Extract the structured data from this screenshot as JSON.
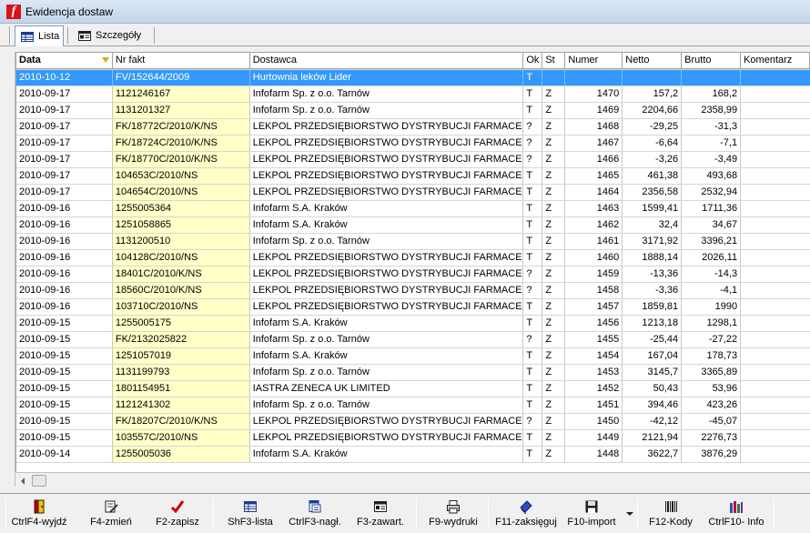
{
  "window": {
    "title": "Ewidencja dostaw"
  },
  "tabs": [
    {
      "label": "Lista"
    },
    {
      "label": "Szczegóły"
    }
  ],
  "columns": {
    "data": "Data",
    "nr": "Nr fakt",
    "dost": "Dostawca",
    "ok": "Ok",
    "st": "St",
    "num": "Numer",
    "netto": "Netto",
    "brutto": "Brutto",
    "kom": "Komentarz"
  },
  "rows": [
    {
      "data": "2010-10-12",
      "nr": "FV/152644/2009",
      "dost": "Hurtownia leków Lider",
      "ok": "T",
      "st": "",
      "num": "",
      "netto": "",
      "brutto": "",
      "kom": ""
    },
    {
      "data": "2010-09-17",
      "nr": "1121246167",
      "dost": "Infofarm Sp. z o.o. Tarnów",
      "ok": "T",
      "st": "Z",
      "num": "1470",
      "netto": "157,2",
      "brutto": "168,2",
      "kom": ""
    },
    {
      "data": "2010-09-17",
      "nr": "1131201327",
      "dost": "Infofarm Sp. z o.o. Tarnów",
      "ok": "T",
      "st": "Z",
      "num": "1469",
      "netto": "2204,66",
      "brutto": "2358,99",
      "kom": ""
    },
    {
      "data": "2010-09-17",
      "nr": "FK/18772C/2010/K/NS",
      "dost": "LEKPOL PRZEDSIĘBIORSTWO DYSTRYBUCJI FARMACEU",
      "ok": "?",
      "st": "Z",
      "num": "1468",
      "netto": "-29,25",
      "brutto": "-31,3",
      "kom": ""
    },
    {
      "data": "2010-09-17",
      "nr": "FK/18724C/2010/K/NS",
      "dost": "LEKPOL PRZEDSIĘBIORSTWO DYSTRYBUCJI FARMACEU",
      "ok": "?",
      "st": "Z",
      "num": "1467",
      "netto": "-6,64",
      "brutto": "-7,1",
      "kom": ""
    },
    {
      "data": "2010-09-17",
      "nr": "FK/18770C/2010/K/NS",
      "dost": "LEKPOL PRZEDSIĘBIORSTWO DYSTRYBUCJI FARMACEU",
      "ok": "?",
      "st": "Z",
      "num": "1466",
      "netto": "-3,26",
      "brutto": "-3,49",
      "kom": ""
    },
    {
      "data": "2010-09-17",
      "nr": "104653C/2010/NS",
      "dost": "LEKPOL PRZEDSIĘBIORSTWO DYSTRYBUCJI FARMACEU",
      "ok": "T",
      "st": "Z",
      "num": "1465",
      "netto": "461,38",
      "brutto": "493,68",
      "kom": ""
    },
    {
      "data": "2010-09-17",
      "nr": "104654C/2010/NS",
      "dost": "LEKPOL PRZEDSIĘBIORSTWO DYSTRYBUCJI FARMACEU",
      "ok": "T",
      "st": "Z",
      "num": "1464",
      "netto": "2356,58",
      "brutto": "2532,94",
      "kom": ""
    },
    {
      "data": "2010-09-16",
      "nr": "1255005364",
      "dost": "Infofarm S.A. Kraków",
      "ok": "T",
      "st": "Z",
      "num": "1463",
      "netto": "1599,41",
      "brutto": "1711,36",
      "kom": ""
    },
    {
      "data": "2010-09-16",
      "nr": "1251058865",
      "dost": "Infofarm S.A. Kraków",
      "ok": "T",
      "st": "Z",
      "num": "1462",
      "netto": "32,4",
      "brutto": "34,67",
      "kom": ""
    },
    {
      "data": "2010-09-16",
      "nr": "1131200510",
      "dost": "Infofarm Sp. z o.o. Tarnów",
      "ok": "T",
      "st": "Z",
      "num": "1461",
      "netto": "3171,92",
      "brutto": "3396,21",
      "kom": ""
    },
    {
      "data": "2010-09-16",
      "nr": "104128C/2010/NS",
      "dost": "LEKPOL PRZEDSIĘBIORSTWO DYSTRYBUCJI FARMACEU",
      "ok": "T",
      "st": "Z",
      "num": "1460",
      "netto": "1888,14",
      "brutto": "2026,11",
      "kom": ""
    },
    {
      "data": "2010-09-16",
      "nr": "18401C/2010/K/NS",
      "dost": "LEKPOL PRZEDSIĘBIORSTWO DYSTRYBUCJI FARMACEU",
      "ok": "?",
      "st": "Z",
      "num": "1459",
      "netto": "-13,36",
      "brutto": "-14,3",
      "kom": ""
    },
    {
      "data": "2010-09-16",
      "nr": "18560C/2010/K/NS",
      "dost": "LEKPOL PRZEDSIĘBIORSTWO DYSTRYBUCJI FARMACEU",
      "ok": "?",
      "st": "Z",
      "num": "1458",
      "netto": "-3,36",
      "brutto": "-4,1",
      "kom": ""
    },
    {
      "data": "2010-09-16",
      "nr": "103710C/2010/NS",
      "dost": "LEKPOL PRZEDSIĘBIORSTWO DYSTRYBUCJI FARMACEU",
      "ok": "T",
      "st": "Z",
      "num": "1457",
      "netto": "1859,81",
      "brutto": "1990",
      "kom": ""
    },
    {
      "data": "2010-09-15",
      "nr": "1255005175",
      "dost": "Infofarm S.A. Kraków",
      "ok": "T",
      "st": "Z",
      "num": "1456",
      "netto": "1213,18",
      "brutto": "1298,1",
      "kom": ""
    },
    {
      "data": "2010-09-15",
      "nr": "FK/2132025822",
      "dost": "Infofarm Sp. z o.o. Tarnów",
      "ok": "?",
      "st": "Z",
      "num": "1455",
      "netto": "-25,44",
      "brutto": "-27,22",
      "kom": ""
    },
    {
      "data": "2010-09-15",
      "nr": "1251057019",
      "dost": "Infofarm S.A. Kraków",
      "ok": "T",
      "st": "Z",
      "num": "1454",
      "netto": "167,04",
      "brutto": "178,73",
      "kom": ""
    },
    {
      "data": "2010-09-15",
      "nr": "1131199793",
      "dost": "Infofarm Sp. z o.o. Tarnów",
      "ok": "T",
      "st": "Z",
      "num": "1453",
      "netto": "3145,7",
      "brutto": "3365,89",
      "kom": ""
    },
    {
      "data": "2010-09-15",
      "nr": "1801154951",
      "dost": "IASTRA ZENECA UK LIMITED",
      "ok": "T",
      "st": "Z",
      "num": "1452",
      "netto": "50,43",
      "brutto": "53,96",
      "kom": ""
    },
    {
      "data": "2010-09-15",
      "nr": "1121241302",
      "dost": "Infofarm Sp. z o.o. Tarnów",
      "ok": "T",
      "st": "Z",
      "num": "1451",
      "netto": "394,46",
      "brutto": "423,26",
      "kom": ""
    },
    {
      "data": "2010-09-15",
      "nr": "FK/18207C/2010/K/NS",
      "dost": "LEKPOL PRZEDSIĘBIORSTWO DYSTRYBUCJI FARMACEU",
      "ok": "?",
      "st": "Z",
      "num": "1450",
      "netto": "-42,12",
      "brutto": "-45,07",
      "kom": ""
    },
    {
      "data": "2010-09-15",
      "nr": "103557C/2010/NS",
      "dost": "LEKPOL PRZEDSIĘBIORSTWO DYSTRYBUCJI FARMACEU",
      "ok": "T",
      "st": "Z",
      "num": "1449",
      "netto": "2121,94",
      "brutto": "2276,73",
      "kom": ""
    },
    {
      "data": "2010-09-14",
      "nr": "1255005036",
      "dost": "Infofarm S.A. Kraków",
      "ok": "T",
      "st": "Z",
      "num": "1448",
      "netto": "3622,7",
      "brutto": "3876,29",
      "kom": ""
    }
  ],
  "toolbar": {
    "exit": "CtrlF4-wyjdź",
    "edit": "F4-zmień",
    "save": "F2-zapisz",
    "list": "ShF3-lista",
    "header": "CtrlF3-nagł.",
    "contents": "F3-zawart.",
    "print": "F9-wydruki",
    "post": "F11-zaksięguj",
    "import": "F10-import",
    "codes": "F12-Kody",
    "info": "CtrlF10- Info"
  },
  "colors": {
    "selection": "#3399ff",
    "invoice_cell": "#ffffc8",
    "app_icon": "#d8131b"
  }
}
